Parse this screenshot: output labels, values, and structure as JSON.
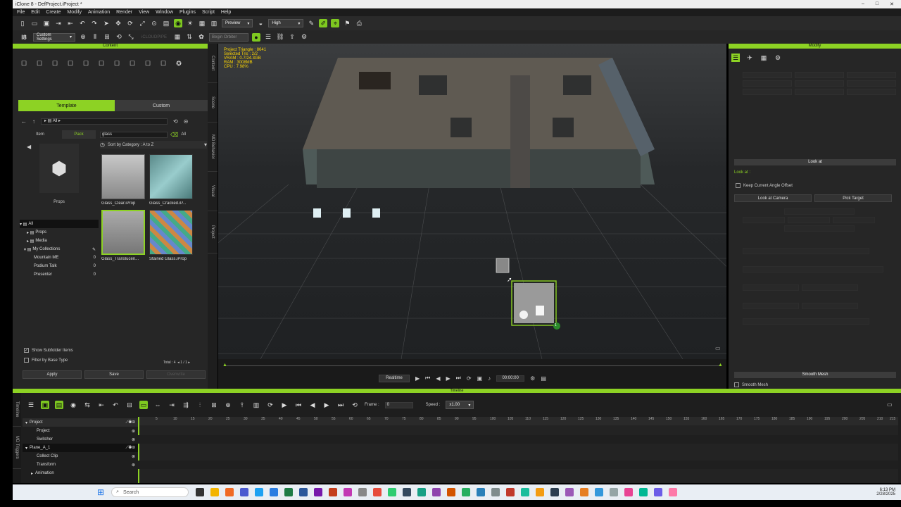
{
  "window": {
    "title": "iClone 8 - DefProject.iProject *"
  },
  "menu": [
    "File",
    "Edit",
    "Create",
    "Modify",
    "Animation",
    "Render",
    "View",
    "Window",
    "Plugins",
    "Script",
    "Help"
  ],
  "toolbar": {
    "preview_label": "Preview",
    "quality_label": "High",
    "custom_settings": "Custom Settings",
    "begin_orbit": "Begin Orbiter",
    "iclonepedia": "iCLOUDPIPE"
  },
  "content": {
    "title": "Content",
    "tab_template": "Template",
    "tab_custom": "Custom",
    "breadcrumb": "All",
    "subtab_item": "Item",
    "subtab_pack": "Pack",
    "preview_caption": "Props",
    "search_value": "glass",
    "search_scope": "All",
    "sort_label": "Sort by Category : A to Z",
    "items": [
      {
        "name": "Glass_Clear.iProp"
      },
      {
        "name": "Glass_Cracked.iP..."
      },
      {
        "name": "Glass_Translucen..."
      },
      {
        "name": "Stained Glass.iProp"
      }
    ],
    "tree": [
      {
        "label": "All",
        "count": ""
      },
      {
        "label": "Props",
        "count": ""
      },
      {
        "label": "Media",
        "count": ""
      },
      {
        "label": "My Collections",
        "count": ""
      },
      {
        "label": "Mountain ME",
        "count": "0"
      },
      {
        "label": "Podium Talk",
        "count": "0"
      },
      {
        "label": "Presenter",
        "count": "0"
      }
    ],
    "show_subfolder": "Show Subfolder Items",
    "filter_base": "Filter by Base Type",
    "total": "Total : 4",
    "pager": "1 / 1",
    "apply": "Apply",
    "save": "Save",
    "overwrite": "Overwrite"
  },
  "side_tabs": [
    "Content",
    "Scene",
    "MD Behavior",
    "Visual",
    "Project"
  ],
  "viewport_stats": {
    "line1": "Project Triangle : 8641",
    "line2": "Selected Tris : 2/2",
    "line3": "VRAM : 0.7/24.3GB",
    "line4": "RAM : 3008MB",
    "line5": "CPU : 7.98%"
  },
  "playbar": {
    "realtime": "Realtime",
    "time": "00:00:00"
  },
  "modify": {
    "title": "Modify",
    "look_at": "Look at",
    "look_at_label": "Look at :",
    "keep_offset": "Keep Current Angle Offset",
    "look_at_camera": "Look at Camera",
    "pick_target": "Pick Target",
    "smooth_mesh_section": "Smooth Mesh",
    "smooth_mesh": "Smooth Mesh"
  },
  "timeline": {
    "title": "Timeline",
    "frame_label": "Frame :",
    "frame_value": "0",
    "speed_label": "Speed :",
    "speed_value": "x1.00",
    "ruler": [
      "5",
      "10",
      "15",
      "20",
      "25",
      "30",
      "35",
      "40",
      "45",
      "50",
      "55",
      "60",
      "65",
      "70",
      "75",
      "80",
      "85",
      "90",
      "95",
      "100",
      "105",
      "110",
      "115",
      "120",
      "125",
      "130",
      "135",
      "140",
      "145",
      "150",
      "155",
      "160",
      "165",
      "170",
      "175",
      "180",
      "185",
      "190",
      "195",
      "200",
      "205",
      "210",
      "215"
    ],
    "tracks": [
      {
        "label": "Project",
        "level": 0
      },
      {
        "label": "Project",
        "level": 1
      },
      {
        "label": "Switcher",
        "level": 1
      },
      {
        "label": "Plane_A_1",
        "level": 0
      },
      {
        "label": "Collect Clip",
        "level": 1
      },
      {
        "label": "Transform",
        "level": 1
      },
      {
        "label": "Animation",
        "level": 1
      }
    ],
    "side_labels": [
      "Timeline",
      "MD Triggers"
    ]
  },
  "taskbar": {
    "search": "Search",
    "time": "6:13 PM",
    "date": "2/28/2025"
  },
  "viewport_badge": "1"
}
